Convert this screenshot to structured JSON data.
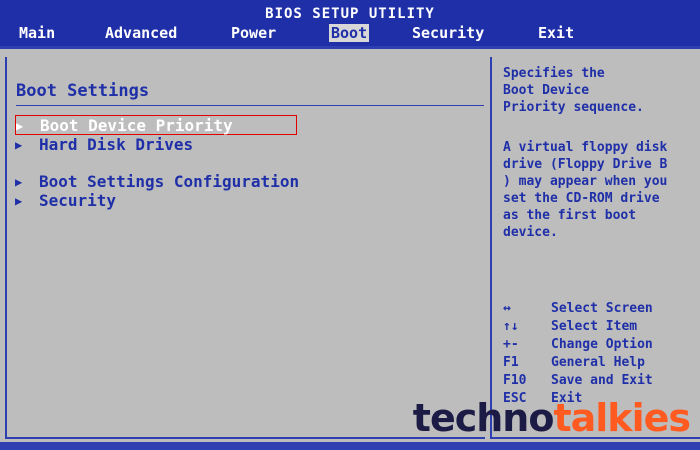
{
  "header": {
    "title": "BIOS SETUP UTILITY",
    "tabs": [
      {
        "label": "Main"
      },
      {
        "label": "Advanced"
      },
      {
        "label": "Power"
      },
      {
        "label": "Boot"
      },
      {
        "label": "Security"
      },
      {
        "label": "Exit"
      }
    ],
    "active_tab": "Boot"
  },
  "main": {
    "section_title": "Boot Settings",
    "items": [
      {
        "label": "Boot Device Priority"
      },
      {
        "label": "Hard Disk Drives"
      },
      {
        "label": "Boot Settings Configuration"
      },
      {
        "label": "Security"
      }
    ],
    "selected_item": "Boot Device Priority"
  },
  "help": {
    "text_1": "Specifies the\nBoot Device\nPriority sequence.",
    "text_2": "A virtual floppy disk\ndrive (Floppy Drive B\n) may appear when you\nset the CD-ROM drive\nas the first boot\ndevice."
  },
  "keys": [
    {
      "key": "↔",
      "action": "Select Screen"
    },
    {
      "key": "↑↓",
      "action": "Select Item"
    },
    {
      "key": "+-",
      "action": "Change Option"
    },
    {
      "key": "F1",
      "action": "General Help"
    },
    {
      "key": "F10",
      "action": "Save and Exit"
    },
    {
      "key": "ESC",
      "action": "Exit"
    }
  ],
  "watermark": {
    "part_1": "techno",
    "part_2": "talkies"
  },
  "colors": {
    "blue": "#1f2fa8",
    "selection_border": "#e00000",
    "background": "#bdbdbd"
  }
}
